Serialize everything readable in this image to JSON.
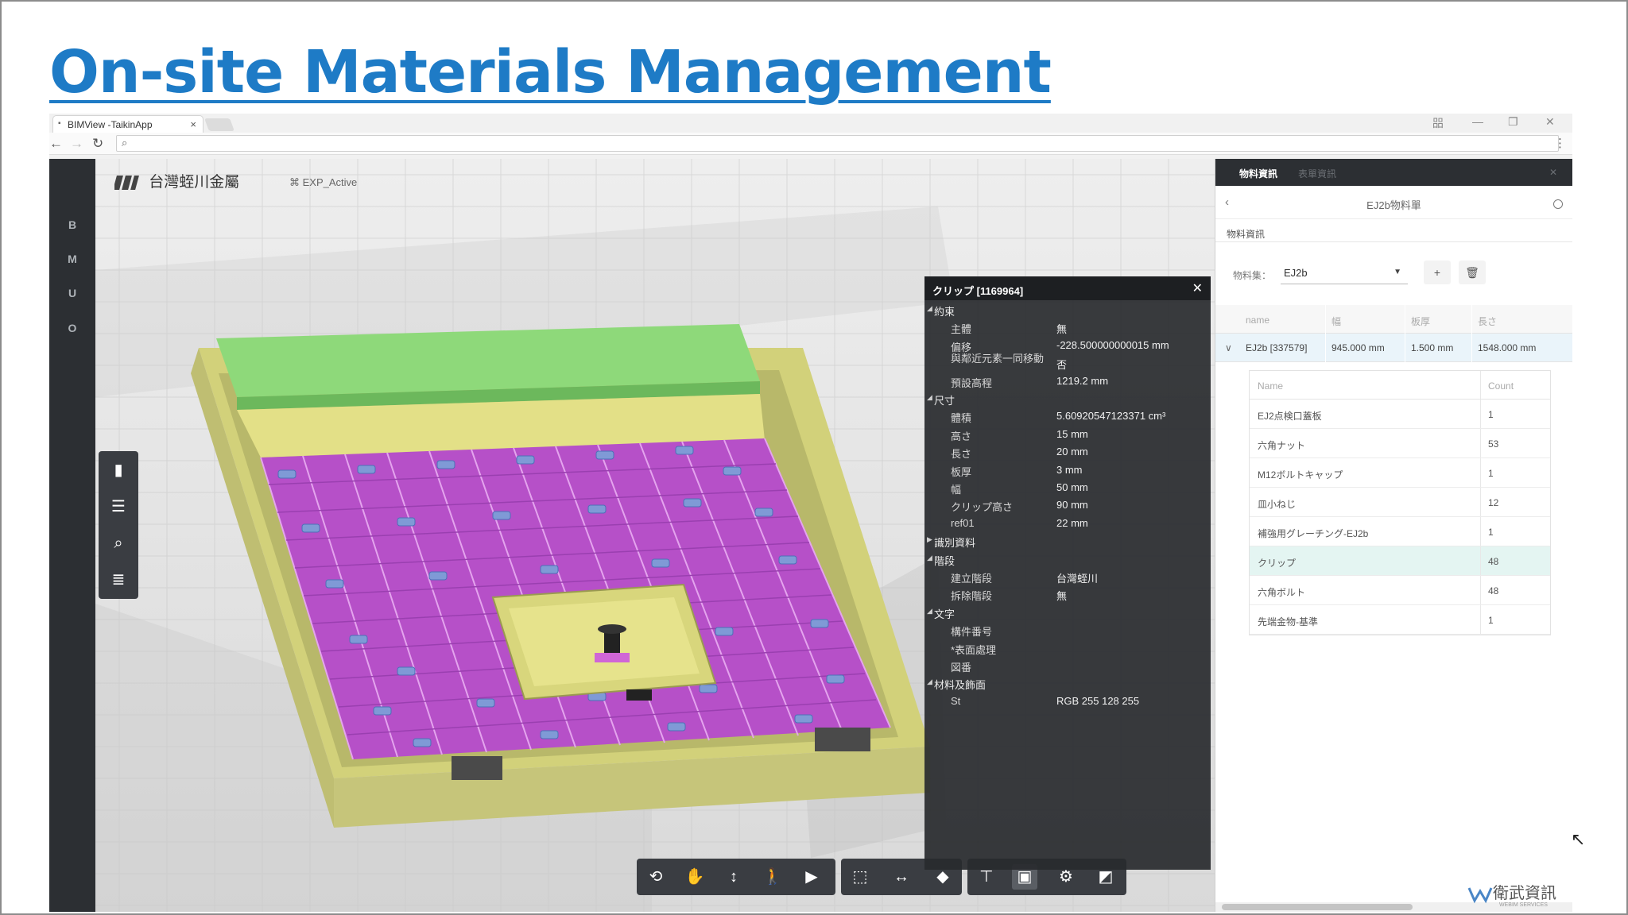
{
  "slide": {
    "title": "On-site Materials Management"
  },
  "browser": {
    "tab_title": "BIMView -TaikinApp",
    "tab_close": "×",
    "window_controls": [
      "—",
      "❐",
      "✕"
    ],
    "user_badge": "㗊"
  },
  "app": {
    "left_nav": [
      "B",
      "M",
      "U",
      "O"
    ],
    "logo_text": "台灣蛭川金屬",
    "model_label": "EXP_Active",
    "side_tools": [
      "chart-icon",
      "layers-icon",
      "search-icon",
      "list-icon"
    ],
    "bottom_tools": [
      "orbit-icon",
      "pan-icon",
      "zoom-icon",
      "walk-icon",
      "camera-icon",
      "section-box-icon",
      "measure-icon",
      "cube-icon",
      "tree-icon",
      "properties-icon",
      "settings-icon",
      "fullscreen-icon"
    ]
  },
  "properties": {
    "title": "クリップ [1169964]",
    "rows": [
      {
        "type": "cat",
        "key": "約束",
        "open": true
      },
      {
        "key": "主體",
        "value": "無"
      },
      {
        "key": "偏移",
        "value": "-228.500000000015 mm"
      },
      {
        "key": "與鄰近元素一同移動",
        "value": "否"
      },
      {
        "key": "預設高程",
        "value": "1219.2 mm"
      },
      {
        "type": "cat",
        "key": "尺寸",
        "open": true
      },
      {
        "key": "體積",
        "value": "5.60920547123371 cm³"
      },
      {
        "key": "高さ",
        "value": "15 mm"
      },
      {
        "key": "長さ",
        "value": "20 mm"
      },
      {
        "key": "板厚",
        "value": "3 mm"
      },
      {
        "key": "幅",
        "value": "50 mm"
      },
      {
        "key": "クリップ高さ",
        "value": "90 mm"
      },
      {
        "key": "ref01",
        "value": "22 mm"
      },
      {
        "type": "cat",
        "key": "識別資料",
        "open": false
      },
      {
        "type": "cat",
        "key": "階段",
        "open": true
      },
      {
        "key": "建立階段",
        "value": "台灣蛭川"
      },
      {
        "key": "拆除階段",
        "value": "無"
      },
      {
        "type": "cat",
        "key": "文字",
        "open": true
      },
      {
        "key": "構件番号",
        "value": ""
      },
      {
        "key": "*表面處理",
        "value": ""
      },
      {
        "key": "図番",
        "value": ""
      },
      {
        "type": "cat",
        "key": "材料及飾面",
        "open": true
      },
      {
        "key": "St",
        "value": "RGB 255 128 255"
      }
    ]
  },
  "material_panel": {
    "tabs": [
      "物料資訊",
      "表單資訊"
    ],
    "title": "EJ2b物料單",
    "section": "物料資訊",
    "material_set_label": "物料集：",
    "material_set_value": "EJ2b",
    "add_label": "+",
    "delete_label": "🗑",
    "columns": [
      "name",
      "幅",
      "板厚",
      "長さ"
    ],
    "row": {
      "name": "EJ2b [337579]",
      "width": "945.000 mm",
      "thickness": "1.500 mm",
      "length": "1548.000 mm"
    },
    "sub_columns": [
      "Name",
      "Count"
    ],
    "items": [
      {
        "name": "EJ2点検口蓋板",
        "count": "1"
      },
      {
        "name": "六角ナット",
        "count": "53"
      },
      {
        "name": "M12ボルトキャップ",
        "count": "1"
      },
      {
        "name": "皿小ねじ",
        "count": "12"
      },
      {
        "name": "補強用グレーチング-EJ2b",
        "count": "1"
      },
      {
        "name": "クリップ",
        "count": "48"
      },
      {
        "name": "六角ボルト",
        "count": "48"
      },
      {
        "name": "先端金物-基準",
        "count": "1"
      }
    ],
    "highlight_item": "クリップ"
  },
  "footer": {
    "logo_text": "衛武資訊",
    "logo_sub": "WEBIM SERVICES"
  },
  "colors": {
    "title_blue": "#1e7bc6",
    "platform_yellow": "#d8d77e",
    "grating_purple": "#b650c8",
    "lid_green": "#8ed97a",
    "clip_blue": "#7f9ad6"
  }
}
